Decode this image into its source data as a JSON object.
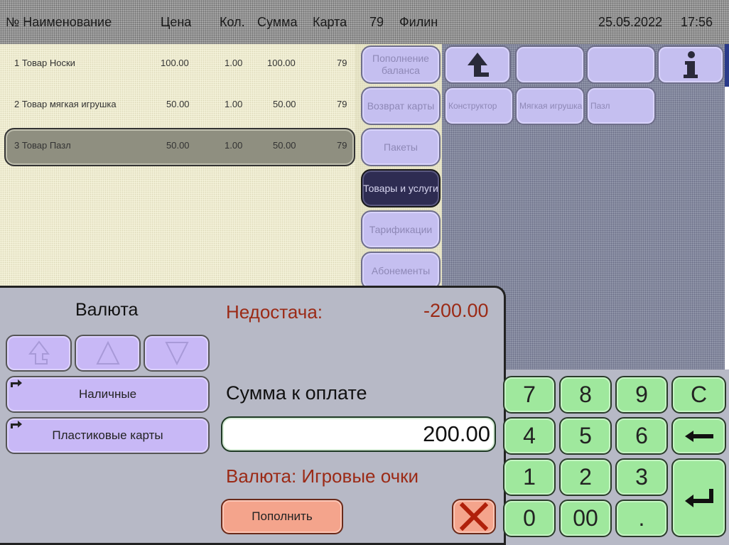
{
  "header": {
    "col_name": "№ Наименование",
    "col_price": "Цена",
    "col_qty": "Кол.",
    "col_sum": "Сумма",
    "col_card": "Карта",
    "card_number": "79",
    "cashier": "Филин",
    "date": "25.05.2022",
    "time": "17:56"
  },
  "receipt": {
    "rows": [
      {
        "name": "1 Товар Носки",
        "price": "100.00",
        "qty": "1.00",
        "sum": "100.00",
        "card": "79"
      },
      {
        "name": "2 Товар мягкая игрушка",
        "price": "50.00",
        "qty": "1.00",
        "sum": "50.00",
        "card": "79"
      },
      {
        "name": "3 Товар Пазл",
        "price": "50.00",
        "qty": "1.00",
        "sum": "50.00",
        "card": "79"
      }
    ]
  },
  "categories": [
    {
      "label": "Пополнение баланса"
    },
    {
      "label": "Возврат карты"
    },
    {
      "label": "Пакеты"
    },
    {
      "label": "Товары и услуги"
    },
    {
      "label": "Тарификации"
    },
    {
      "label": "Абонементы"
    }
  ],
  "products": {
    "items": [
      {
        "label": "Конструктор"
      },
      {
        "label": "Мягкая игрушка"
      },
      {
        "label": "Пазл"
      }
    ],
    "up_icon": "up-arrow-icon",
    "info_icon": "info-icon"
  },
  "payment": {
    "currency_title": "Валюта",
    "methods": [
      {
        "label": "Наличные"
      },
      {
        "label": "Пластиковые карты"
      }
    ],
    "shortage_label": "Недостача:",
    "shortage_value": "-200.00",
    "due_label": "Сумма к оплате",
    "amount": "200.00",
    "currency_line": "Валюта: Игровые очки",
    "topup_label": "Пополнить"
  },
  "keypad": {
    "k7": "7",
    "k8": "8",
    "k9": "9",
    "clear": "C",
    "k4": "4",
    "k5": "5",
    "k6": "6",
    "k1": "1",
    "k2": "2",
    "k3": "3",
    "k0": "0",
    "k00": "00",
    "dot": "."
  },
  "colors": {
    "accent_red": "#9b2a16",
    "keypad_green": "#9fe89d",
    "button_violet": "#c8b8f6",
    "topup_salmon": "#f4a48c"
  }
}
